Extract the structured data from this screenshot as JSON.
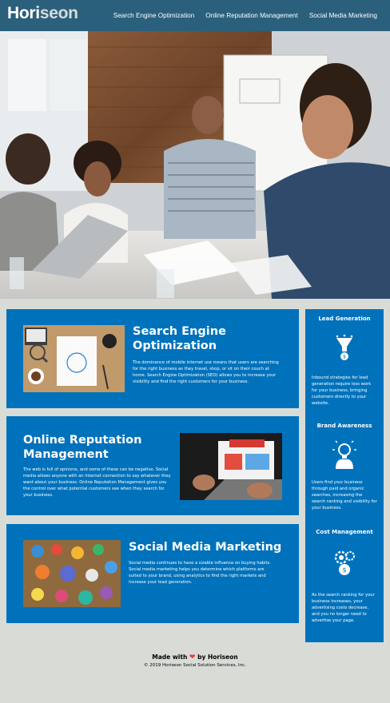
{
  "header": {
    "logo_main": "Hori",
    "logo_accent": "seon",
    "nav": [
      {
        "label": "Search Engine Optimization"
      },
      {
        "label": "Online Reputation Management"
      },
      {
        "label": "Social Media Marketing"
      }
    ]
  },
  "hero": {
    "image_name": "team meeting photo"
  },
  "cards": [
    {
      "title": "Search Engine Optimization",
      "body": "The dominance of mobile internet use means that users are searching for the right business as they travel, shop, or sit on their couch at home. Search Engine Optimization (SEO) allows you to increase your visibility and find the right customers for your business."
    },
    {
      "title": "Online Reputation Management",
      "body": "The web is full of opinions, and some of these can be negative. Social media allows anyone with an internet connection to say whatever they want about your business. Online Reputation Management gives you the control over what potential customers see when they search for your business."
    },
    {
      "title": "Social Media Marketing",
      "body": "Social media continues to have a sizable influence on buying habits. Social media marketing helps you determine which platforms are suited to your brand, using analytics to find the right markets and increase your lead generation."
    }
  ],
  "benefits": [
    {
      "title": "Lead Generation",
      "icon": "lead-funnel-icon",
      "body": "Inbound strategies for lead generation require less work for your business, bringing customers directly to your website."
    },
    {
      "title": "Brand Awareness",
      "icon": "brand-bulb-icon",
      "body": "Users find your business through paid and organic searches, increasing the search ranking and visibility for your business."
    },
    {
      "title": "Cost Management",
      "icon": "cost-gears-icon",
      "body": "As the search ranking for your business increases, your advertising costs decrease, and you no longer need to advertise your page."
    }
  ],
  "footer": {
    "made_prefix": "Made with",
    "made_suffix": "by Horiseon",
    "copyright": "© 2019 Horiseon Social Solution Services, Inc."
  },
  "colors": {
    "header_bg": "#2a607c",
    "card_bg": "#0072bb",
    "page_bg": "#d9dcd6",
    "heart": "#e8403b"
  }
}
